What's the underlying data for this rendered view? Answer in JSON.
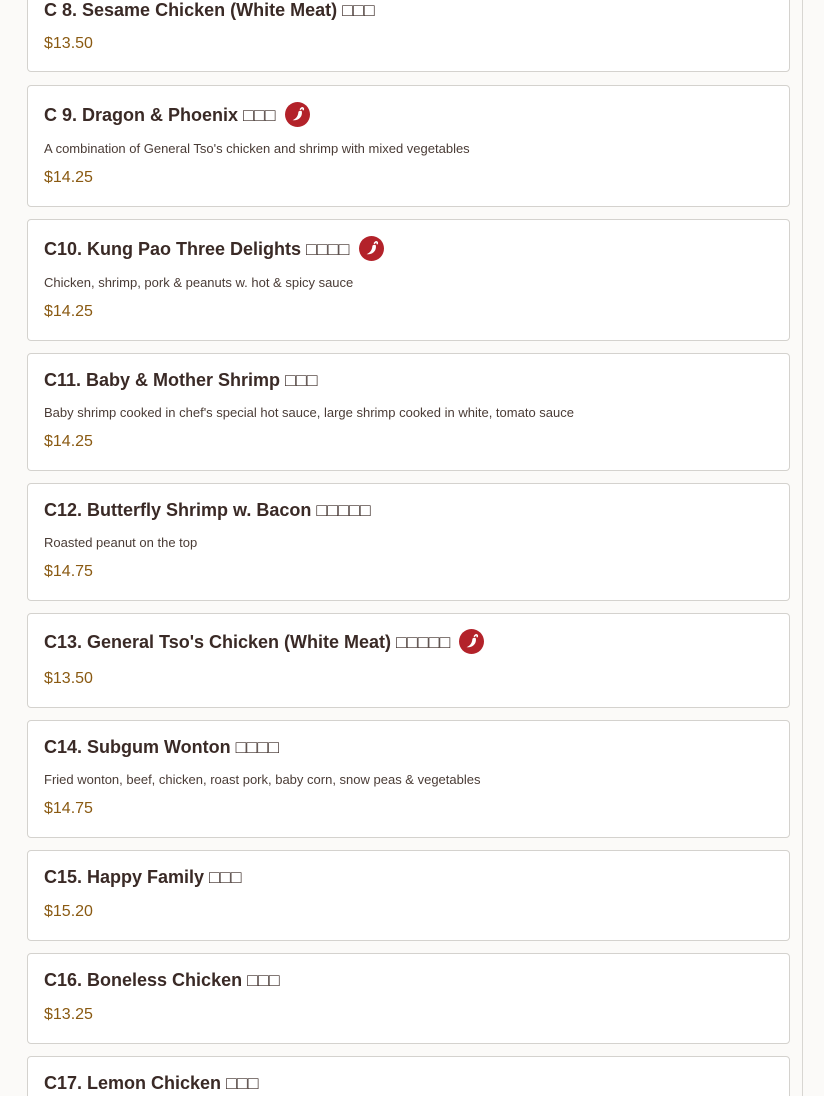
{
  "menu": {
    "items": [
      {
        "title": "C 8. Sesame Chicken (White Meat) □□□",
        "description": "",
        "price": "$13.50",
        "spicy": false
      },
      {
        "title": "C 9. Dragon & Phoenix □□□",
        "description": "A combination of General Tso's chicken and shrimp with mixed vegetables",
        "price": "$14.25",
        "spicy": true
      },
      {
        "title": "C10. Kung Pao Three Delights □□□□",
        "description": "Chicken, shrimp, pork & peanuts w. hot & spicy sauce",
        "price": "$14.25",
        "spicy": true
      },
      {
        "title": "C11. Baby & Mother Shrimp □□□",
        "description": "Baby shrimp cooked in chef's special hot sauce, large shrimp cooked in white, tomato sauce",
        "price": "$14.25",
        "spicy": false
      },
      {
        "title": "C12. Butterfly Shrimp w. Bacon □□□□□",
        "description": "Roasted peanut on the top",
        "price": "$14.75",
        "spicy": false
      },
      {
        "title": "C13. General Tso's Chicken (White Meat) □□□□□",
        "description": "",
        "price": "$13.50",
        "spicy": true
      },
      {
        "title": "C14. Subgum Wonton □□□□",
        "description": "Fried wonton, beef, chicken, roast pork, baby corn, snow peas & vegetables",
        "price": "$14.75",
        "spicy": false
      },
      {
        "title": "C15. Happy Family □□□",
        "description": "",
        "price": "$15.20",
        "spicy": false
      },
      {
        "title": "C16. Boneless Chicken □□□",
        "description": "",
        "price": "$13.25",
        "spicy": false
      },
      {
        "title": "C17. Lemon Chicken □□□",
        "description": "",
        "price": "",
        "spicy": false
      }
    ]
  },
  "colors": {
    "page_background": "#fbfaf8",
    "card_border": "#d4d2ce",
    "title_text": "#3a2a26",
    "price_text": "#8a5a12",
    "spicy_badge": "#b3222a"
  },
  "icons": {
    "spicy": "chili-pepper-icon"
  }
}
